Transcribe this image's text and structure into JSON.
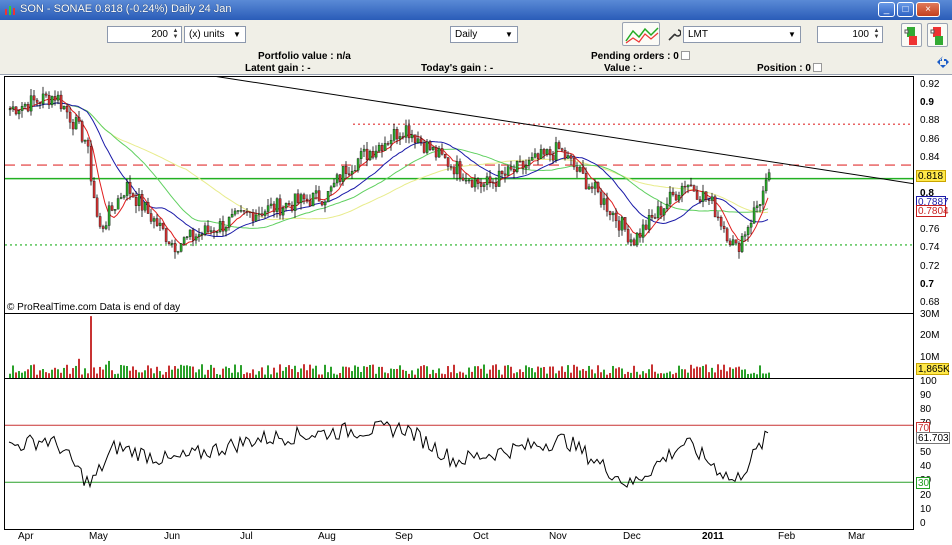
{
  "window": {
    "title": "SON - SONAE   0.818 (-0.24%)   Daily  24 Jan",
    "controls": [
      "_",
      "□",
      "×"
    ]
  },
  "toolbar": {
    "quantity_value": "200",
    "units_select": "(x) units",
    "period_select": "Daily",
    "order_type_select": "LMT",
    "price_qty_value": "100"
  },
  "info": {
    "portfolio_value": "Portfolio value : n/a",
    "latent_gain": "Latent gain : -",
    "todays_gain": "Today's gain : -",
    "pending_orders": "Pending orders : 0",
    "value": "Value : -",
    "position": "Position : 0"
  },
  "price_axis": [
    "0.92",
    "0.9",
    "0.88",
    "0.86",
    "0.84",
    "0.82",
    "0.8",
    "0.78",
    "0.76",
    "0.74",
    "0.72",
    "0.7",
    "0.68"
  ],
  "price_tags": {
    "last": "0.818",
    "ma1": "0.7887",
    "ma2": "0.7804",
    "last_color": "#ffd700",
    "ma1_color": "#1a1aa8",
    "ma2_color": "#c81e1e"
  },
  "volume_axis": [
    "30M",
    "20M",
    "10M"
  ],
  "volume_tag": "1,865K",
  "rsi_axis": [
    "100",
    "90",
    "80",
    "70",
    "60",
    "50",
    "40",
    "30",
    "20",
    "10",
    "0"
  ],
  "rsi_tags": {
    "upper": "70",
    "value": "61.703",
    "lower": "30"
  },
  "x_axis": [
    "Apr",
    "May",
    "Jun",
    "Jul",
    "Aug",
    "Sep",
    "Oct",
    "Nov",
    "Dec",
    "2011",
    "Feb",
    "Mar"
  ],
  "credit": "© ProRealTime.com  Data is end of day",
  "colors": {
    "up": "#2aa02a",
    "down": "#c83232",
    "ma_short": "#e01e1e",
    "ma_mid": "#1a1aa8",
    "ma_long": "#60d060",
    "ma_vlong": "#e8ec8c",
    "support": "#22b022",
    "resistance": "#e03030",
    "trend": "#000000",
    "rsi_line": "#000000"
  },
  "chart_data": {
    "type": "candlestick",
    "instrument": "SON - SONAE",
    "interval": "Daily",
    "ylim": [
      0.67,
      0.93
    ],
    "horizontal_levels": [
      {
        "value": 0.818,
        "style": "solid",
        "color": "green"
      },
      {
        "value": 0.833,
        "style": "dashed",
        "color": "red"
      },
      {
        "value": 0.878,
        "style": "dotted",
        "color": "red"
      },
      {
        "value": 0.745,
        "style": "dotted",
        "color": "green"
      }
    ],
    "trendline": {
      "start": {
        "date": "Apr",
        "value": 0.935
      },
      "end": {
        "date": "Feb",
        "value": 0.817
      }
    },
    "x_categories": [
      "Apr",
      "May",
      "Jun",
      "Jul",
      "Aug",
      "Sep",
      "Oct",
      "Nov",
      "Dec",
      "2011",
      "Feb",
      "Mar"
    ],
    "close_by_month": [
      0.895,
      0.755,
      0.755,
      0.79,
      0.805,
      0.875,
      0.81,
      0.85,
      0.775,
      0.77,
      0.818
    ],
    "volume": {
      "ylim": [
        0,
        30000000
      ],
      "last": "1,865K"
    },
    "rsi": {
      "ylim": [
        0,
        100
      ],
      "levels": [
        70,
        30
      ],
      "last": 61.703
    }
  }
}
